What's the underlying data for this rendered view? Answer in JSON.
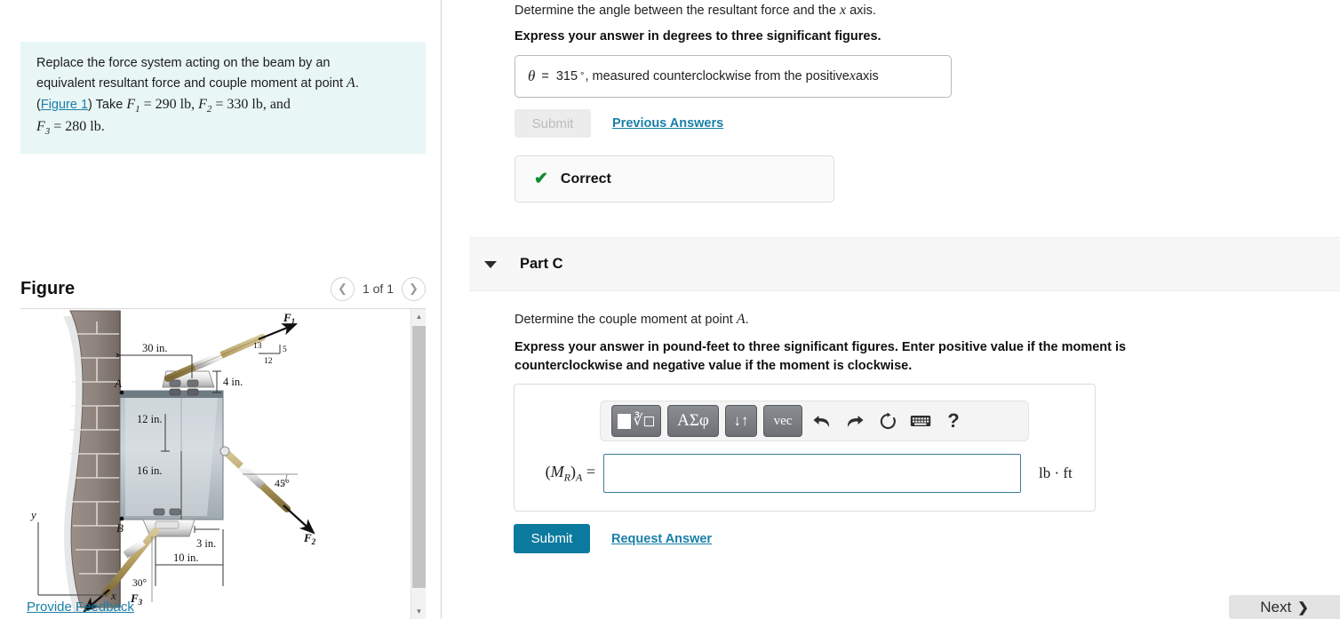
{
  "problem": {
    "line1": "Replace the force system acting on the beam by an",
    "line2_pre": "equivalent resultant force and couple moment at point ",
    "point": "A",
    "line2_post": ".",
    "paren_open": "(",
    "figure_link": "Figure 1",
    "paren_close": ") Take ",
    "f1_sym": "F",
    "f1_sub": "1",
    "f1_val": " = 290 lb, ",
    "f2_sym": "F",
    "f2_sub": "2",
    "f2_val": " = 330 lb, and",
    "f3_sym": "F",
    "f3_sub": "3",
    "f3_val": " = 280 lb."
  },
  "figure_panel": {
    "title": "Figure",
    "counter": "1 of 1",
    "prev_icon": "chevron-left-icon",
    "next_icon": "chevron-right-icon",
    "scroll_up_icon": "triangle-up-icon",
    "scroll_down_icon": "triangle-down-icon",
    "labels": {
      "dim_30": "30 in.",
      "dim_4": "4 in.",
      "dim_12": "12 in.",
      "dim_16": "16 in.",
      "dim_3": "3 in.",
      "dim_10": "10 in.",
      "angle_45": "45°",
      "angle_30": "30°",
      "slope_13": "13",
      "slope_12": "12",
      "slope_5": "5",
      "point_A": "A",
      "point_B": "B",
      "force_1": "F",
      "force_1_sub": "1",
      "force_2": "F",
      "force_2_sub": "2",
      "force_3": "F",
      "force_3_sub": "3",
      "axis_x": "x",
      "axis_y": "y"
    }
  },
  "part_b": {
    "question": "Determine the angle between the resultant force and the x axis.",
    "question_pre": "Determine the angle between the resultant force and the ",
    "question_var": "x",
    "question_post": " axis.",
    "instruction": "Express your answer in degrees to three significant figures.",
    "answer_symbol": "θ",
    "answer_equals": "=",
    "answer_value": "315",
    "answer_degree": "°",
    "answer_suffix_pre": ", measured counterclockwise from the positive ",
    "answer_suffix_var": "x",
    "answer_suffix_post": " axis",
    "submit_label": "Submit",
    "previous_answers_label": "Previous Answers",
    "status_icon": "check-icon",
    "status_label": "Correct",
    "status_color": "#0a8a33"
  },
  "part_c": {
    "header_label": "Part C",
    "caret_icon": "caret-down-icon",
    "question_pre": "Determine the couple moment at point ",
    "question_var": "A",
    "question_post": ".",
    "instruction_line1": "Express your answer in pound-feet to three significant figures. Enter positive value if the moment is",
    "instruction_line2": "counterclockwise and negative value if the moment is clockwise.",
    "toolbar": [
      {
        "name": "template-sqrt-button",
        "label": ""
      },
      {
        "name": "greek-letters-button",
        "label": "ΑΣφ"
      },
      {
        "name": "arrows-button",
        "label": "↓↑"
      },
      {
        "name": "vector-button",
        "label": "vec"
      },
      {
        "name": "undo-icon",
        "label": "↰"
      },
      {
        "name": "redo-icon",
        "label": "↱"
      },
      {
        "name": "reset-icon",
        "label": "↻"
      },
      {
        "name": "keyboard-icon",
        "label": "⌨"
      },
      {
        "name": "help-icon",
        "label": "?"
      }
    ],
    "answer_label_main": "M",
    "answer_label_sub1": "R",
    "answer_label_sub2": "A",
    "answer_equals": "=",
    "answer_value": "",
    "unit": "lb · ft",
    "submit_label": "Submit",
    "request_answer_label": "Request Answer"
  },
  "footer": {
    "feedback_label": "Provide Feedback",
    "next_label": "Next",
    "next_icon": "chevron-right-icon"
  },
  "colors": {
    "accent_teal": "#0c7a9e",
    "link_teal": "#1a7fa8",
    "problem_bg": "#e9f6f6",
    "success_green": "#0a8a33"
  }
}
